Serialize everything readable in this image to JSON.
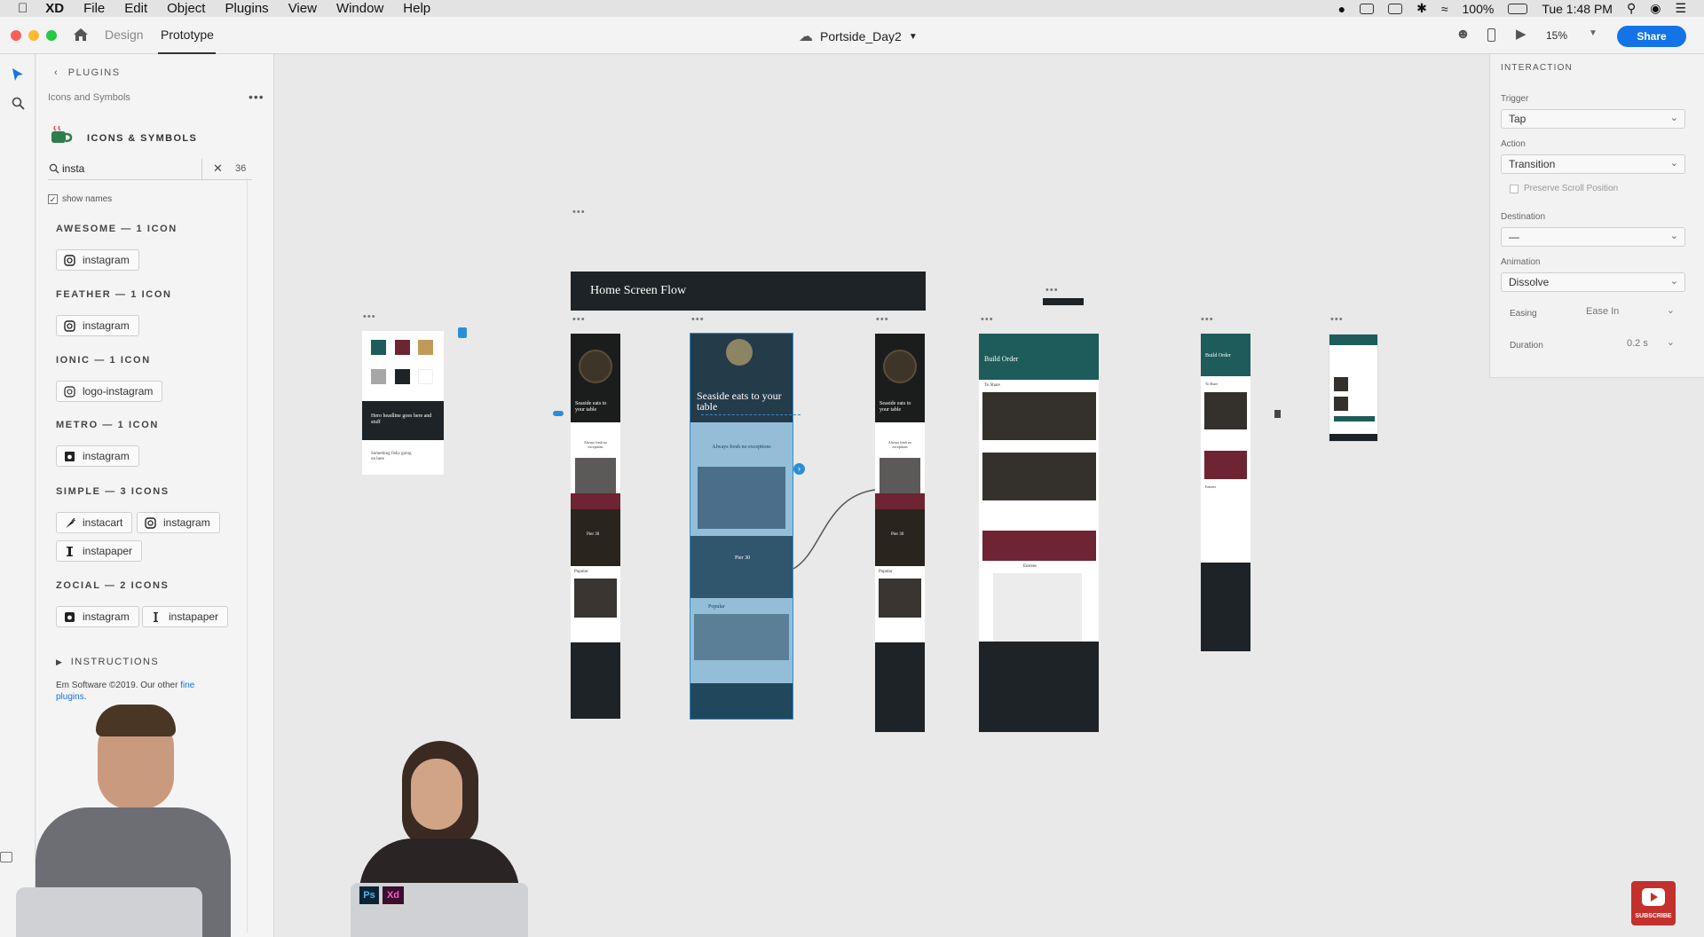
{
  "menubar": {
    "app_name": "XD",
    "items": [
      "File",
      "Edit",
      "Object",
      "Plugins",
      "View",
      "Window",
      "Help"
    ],
    "battery": "100%",
    "clock": "Tue 1:48 PM"
  },
  "titlebar": {
    "tabs": [
      "Design",
      "Prototype"
    ],
    "active_tab": "Prototype",
    "document": "Portside_Day2",
    "zoom": "15%",
    "share_label": "Share"
  },
  "plugin_panel": {
    "back_label": "PLUGINS",
    "subtitle": "Icons and Symbols",
    "plugin_name": "ICONS & SYMBOLS",
    "search": {
      "value": "insta",
      "count": "36"
    },
    "show_names_label": "show names",
    "sections": [
      {
        "title": "AWESOME — 1 ICON",
        "items": [
          "instagram"
        ]
      },
      {
        "title": "FEATHER — 1 ICON",
        "items": [
          "instagram"
        ]
      },
      {
        "title": "IONIC — 1 ICON",
        "items": [
          "logo-instagram"
        ]
      },
      {
        "title": "METRO — 1 ICON",
        "items": [
          "instagram"
        ]
      },
      {
        "title": "SIMPLE — 3 ICONS",
        "items": [
          "instacart",
          "instagram",
          "instapaper"
        ]
      },
      {
        "title": "ZOCIAL — 2 ICONS",
        "items": [
          "instagram",
          "instapaper"
        ]
      }
    ],
    "instructions_label": "INSTRUCTIONS",
    "footer_text": "Em Software ©2019. Our other ",
    "footer_link": "fine plugins",
    "footer_end": "."
  },
  "canvas": {
    "flow_label": "Home Screen Flow",
    "swatch_card_headline": "Hero headline goes here and stuff",
    "swatch_card_sub": "Something fishy going on here",
    "hero_text": "Seaside eats to your table",
    "fresh_text": "Always fresh no exceptions",
    "pier_text": "Pier 30",
    "popular_label": "Popular",
    "build_order": "Build Order",
    "to_share": "To Share",
    "entrees": "Entrees"
  },
  "interaction": {
    "header": "INTERACTION",
    "trigger_label": "Trigger",
    "trigger_value": "Tap",
    "action_label": "Action",
    "action_value": "Transition",
    "preserve_label": "Preserve Scroll Position",
    "destination_label": "Destination",
    "destination_value": "—",
    "animation_label": "Animation",
    "animation_value": "Dissolve",
    "easing_label": "Easing",
    "easing_value": "Ease In",
    "duration_label": "Duration",
    "duration_value": "0.2 s"
  },
  "overlay": {
    "subscribe_label": "SUBSCRIBE",
    "dock_apps": [
      "Ps",
      "Xd"
    ]
  },
  "colors": {
    "accent": "#1473e6",
    "teal": "#1e5b5b",
    "maroon": "#6e2433",
    "gold": "#c09a5b",
    "dark": "#1d2326"
  }
}
